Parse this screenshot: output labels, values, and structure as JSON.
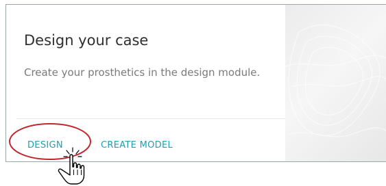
{
  "card": {
    "title": "Design your case",
    "description": "Create your prosthetics in the design module.",
    "buttons": [
      {
        "label": "DESIGN"
      },
      {
        "label": "CREATE MODEL"
      }
    ]
  },
  "colors": {
    "accent": "#1aa0b3",
    "highlight_ring": "#c0272d",
    "card_border": "#9aa7aa"
  },
  "icons": {
    "cursor": "hand-pointer-icon"
  }
}
